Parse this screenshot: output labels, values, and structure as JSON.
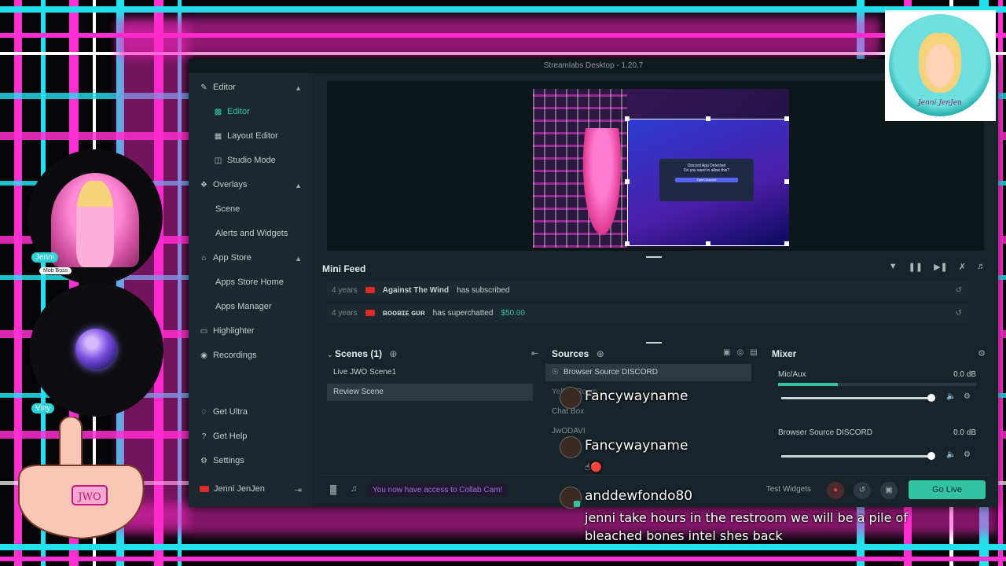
{
  "app": {
    "title": "Streamlabs Desktop - 1.20.7",
    "accent": "#31c3a2"
  },
  "sidebar": {
    "items": [
      {
        "label": "Editor",
        "icon": "edit-icon"
      },
      {
        "label": "Editor",
        "icon": "editor-icon"
      },
      {
        "label": "Layout Editor",
        "icon": "layout-icon"
      },
      {
        "label": "Studio Mode",
        "icon": "studio-mode-icon"
      },
      {
        "label": "Overlays",
        "icon": "overlays-icon"
      },
      {
        "label": "Scene"
      },
      {
        "label": "Alerts and Widgets"
      },
      {
        "label": "App Store",
        "icon": "store-icon"
      },
      {
        "label": "Apps Store Home"
      },
      {
        "label": "Apps Manager"
      },
      {
        "label": "Highlighter",
        "icon": "highlighter-icon"
      },
      {
        "label": "Recordings",
        "icon": "recordings-icon"
      },
      {
        "label": "Get Ultra",
        "icon": "ultra-icon"
      },
      {
        "label": "Get Help",
        "icon": "help-icon"
      },
      {
        "label": "Settings",
        "icon": "gear-icon"
      },
      {
        "label": "Jenni JenJen",
        "icon": "youtube-icon"
      }
    ]
  },
  "preview": {
    "discord_title": "Discord App Detected",
    "discord_body": "Do you want to allow this?",
    "discord_button": "Open Discord"
  },
  "minifeed": {
    "title": "Mini Feed",
    "rows": [
      {
        "time": "4 years",
        "name": "Against The Wind",
        "action": "has subscribed",
        "amount": ""
      },
      {
        "time": "4 years",
        "name": "ʙᴏᴏʙɪᴇ ɢᴜʀ",
        "action": "has superchatted",
        "amount": "$50.00"
      }
    ]
  },
  "scenes": {
    "title": "Scenes (1)",
    "items": [
      "Live JWO Scene1",
      "Review Scene"
    ]
  },
  "sources": {
    "title": "Sources",
    "items": [
      "Browser Source DISCORD",
      "Yellow Room",
      "Chat Box",
      "JwODAVI"
    ]
  },
  "mixer": {
    "title": "Mixer",
    "channels": [
      {
        "name": "Mic/Aux",
        "db": "0.0 dB",
        "level": 0.3
      },
      {
        "name": "Browser Source DISCORD",
        "db": "0.0 dB",
        "level": 0.0
      }
    ]
  },
  "footer": {
    "collab_note": "You now have access to Collab Cam!",
    "test_widgets": "Test Widgets",
    "go_live": "Go Live"
  },
  "overlay": {
    "name_tag_top": "Jenni",
    "role_tag": "Mob Boss",
    "name_tag_bottom": "Viny",
    "logo_text": "Jenni JenJen",
    "hand_ring_text": "JWO"
  },
  "chat": [
    {
      "user": "Fancywayname",
      "message": ""
    },
    {
      "user": "Fancywayname",
      "message": ""
    },
    {
      "user": "anddewfondo80",
      "message": "jenni take hours in the restroom we will be a pile of bleached bones intel shes back"
    }
  ]
}
